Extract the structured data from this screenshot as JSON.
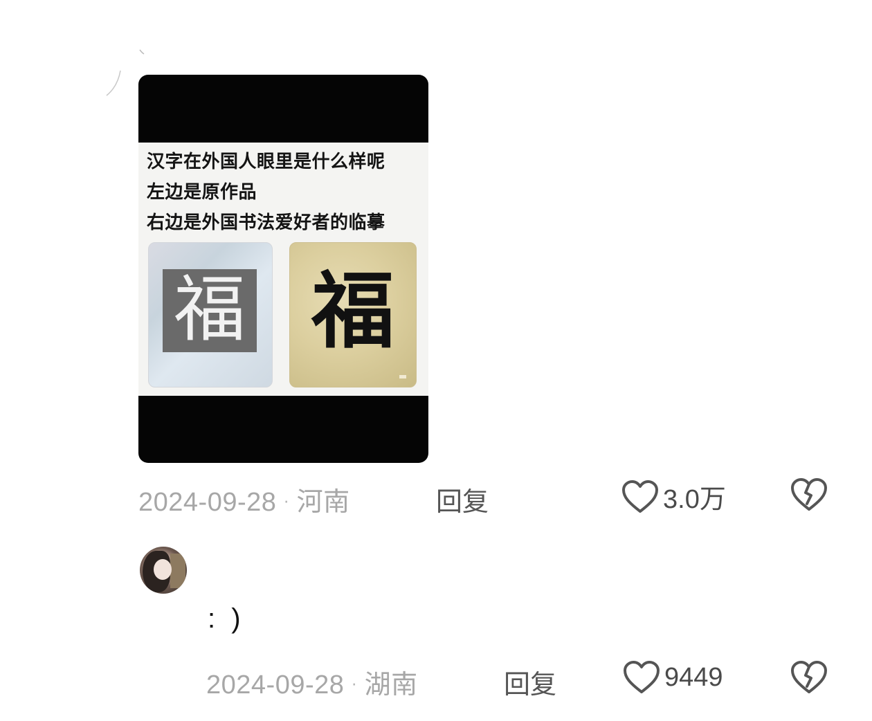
{
  "post": {
    "image_text": {
      "line1": "汉字在外国人眼里是什么样呢",
      "line2": "左边是原作品",
      "line3": "右边是外国书法爱好者的临摹"
    },
    "left_character": "福",
    "right_character": "福",
    "date": "2024-09-28",
    "separator": "·",
    "location": "河南",
    "reply_label": "回复",
    "like_icon": "heart-outline-icon",
    "like_count": "3.0万",
    "dislike_icon": "broken-heart-icon"
  },
  "reply_comment": {
    "avatar": "user-avatar",
    "text": ": )",
    "date": "2024-09-28",
    "separator": "·",
    "location": "湖南",
    "reply_label": "回复",
    "like_icon": "heart-outline-icon",
    "like_count": "9449",
    "dislike_icon": "broken-heart-icon"
  },
  "colors": {
    "meta_gray": "#a7a7a7",
    "reply_gray": "#555555",
    "icon_gray": "#555555",
    "card_black": "#050505"
  }
}
